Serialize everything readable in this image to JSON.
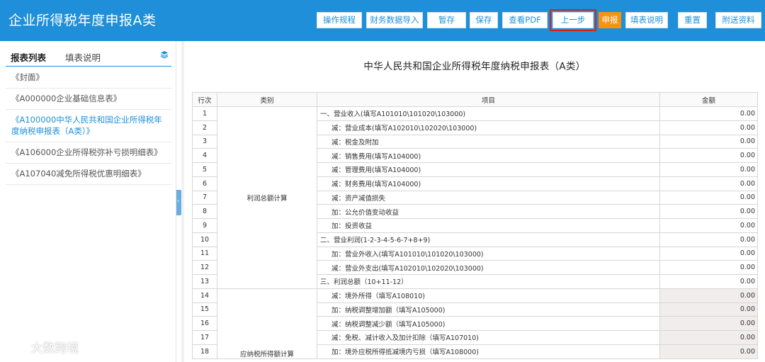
{
  "header": {
    "title": "企业所得税年度申报A类",
    "buttons": [
      "操作规程",
      "财务数据导入",
      "暂存",
      "保存",
      "查看PDF",
      "上一步",
      "申报",
      "填表说明",
      "重置",
      "附送资料"
    ]
  },
  "colors": {
    "header_bg": "#1e8fd8",
    "declare_button": "#f7930f",
    "highlight_border": "#d9221c"
  },
  "sidebar": {
    "tabs": [
      "报表列表",
      "填表说明"
    ],
    "items": [
      "《封面》",
      "《A000000企业基础信息表》",
      "《A100000中华人民共和国企业所得税年度纳税申报表（A类）》",
      "《A106000企业所得税弥补亏损明细表》",
      "《A107040减免所得税优惠明细表》"
    ]
  },
  "report": {
    "title": "中华人民共和国企业所得税年度纳税申报表（A类）",
    "columns": [
      "行次",
      "类别",
      "项目",
      "金额"
    ],
    "categories": [
      "利润总额计算",
      "应纳税所得额计算"
    ],
    "rows": [
      {
        "no": "1",
        "item": "一、营业收入(填写A101010\\101020\\103000)",
        "amount": "0.00"
      },
      {
        "no": "2",
        "item": "减：营业成本(填写A102010\\102020\\103000)",
        "amount": "0.00"
      },
      {
        "no": "3",
        "item": "减：税金及附加",
        "amount": "0.00"
      },
      {
        "no": "4",
        "item": "减：销售费用(填写A104000)",
        "amount": "0.00"
      },
      {
        "no": "5",
        "item": "减：管理费用(填写A104000)",
        "amount": "0.00"
      },
      {
        "no": "6",
        "item": "减：财务费用(填写A104000)",
        "amount": "0.00"
      },
      {
        "no": "7",
        "item": "减：资产减值损失",
        "amount": "0.00"
      },
      {
        "no": "8",
        "item": "加：公允价值变动收益",
        "amount": "0.00"
      },
      {
        "no": "9",
        "item": "加：投资收益",
        "amount": "0.00"
      },
      {
        "no": "10",
        "item": "二、营业利润(1-2-3-4-5-6-7+8+9)",
        "amount": "0.00"
      },
      {
        "no": "11",
        "item": "加：营业外收入(填写A101010\\101020\\103000)",
        "amount": "0.00"
      },
      {
        "no": "12",
        "item": "减：营业外支出(填写A102010\\102020\\103000)",
        "amount": "0.00"
      },
      {
        "no": "13",
        "item": "三、利润总额（10+11-12）",
        "amount": "0.00"
      },
      {
        "no": "14",
        "item": "减：境外所得（填写A108010)",
        "amount": "0.00"
      },
      {
        "no": "15",
        "item": "加：纳税调整增加额（填写A105000)",
        "amount": "0.00"
      },
      {
        "no": "16",
        "item": "减：纳税调整减少额（填写A105000)",
        "amount": "0.00"
      },
      {
        "no": "17",
        "item": "减：免税、减计收入及加计扣除（填写A107010)",
        "amount": "0.00"
      },
      {
        "no": "18",
        "item": "加：境外应税所得抵减境内亏损（填写A108000)",
        "amount": "0.00"
      }
    ]
  },
  "watermark": {
    "text": "大数跨境"
  }
}
